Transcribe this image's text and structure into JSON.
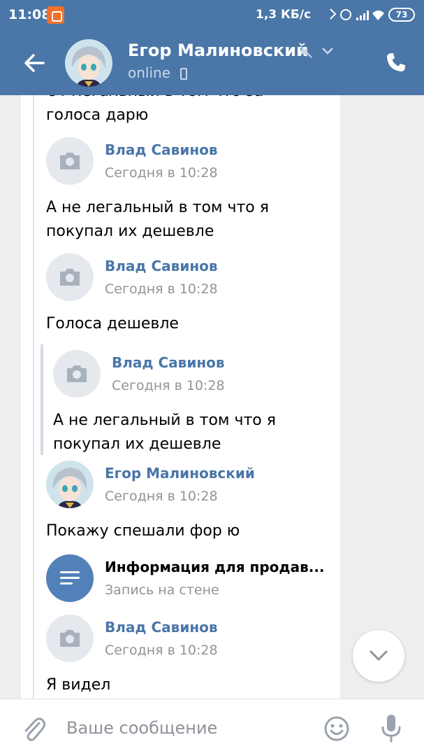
{
  "status_bar": {
    "time": "11:08",
    "network_speed": "1,3 КБ/с",
    "battery": "73"
  },
  "header": {
    "contact_name": "Егор Малиновский",
    "status": "online"
  },
  "messages": {
    "m0_partial": "От легальный в том что за",
    "m0_text": "голоса дарю",
    "m1_author": "Влад Савинов",
    "m1_time": "Сегодня в 10:28",
    "m1_line1": "А не легальный в том что я",
    "m1_line2": "покупал их дешевле",
    "m2_author": "Влад Савинов",
    "m2_time": "Сегодня в 10:28",
    "m2_text": "Голоса дешевле",
    "m3_author": "Влад Савинов",
    "m3_time": "Сегодня в 10:28",
    "m3_line1": "А не легальный в том что я",
    "m3_line2": "покупал их дешевле",
    "m4_author": "Егор Малиновский",
    "m4_time": "Сегодня в 10:28",
    "m4_text": "Покажу спешали фор ю",
    "wall_title": "Информация для продав...",
    "wall_subtitle": "Запись на стене",
    "m5_author": "Влад Савинов",
    "m5_time": "Сегодня в 10:28",
    "m5_text": "Я видел"
  },
  "composer": {
    "placeholder": "Ваше сообщение"
  },
  "colors": {
    "header_bg": "#4a76a8",
    "author_link": "#4a76a8",
    "chat_bg": "#edeef0"
  }
}
